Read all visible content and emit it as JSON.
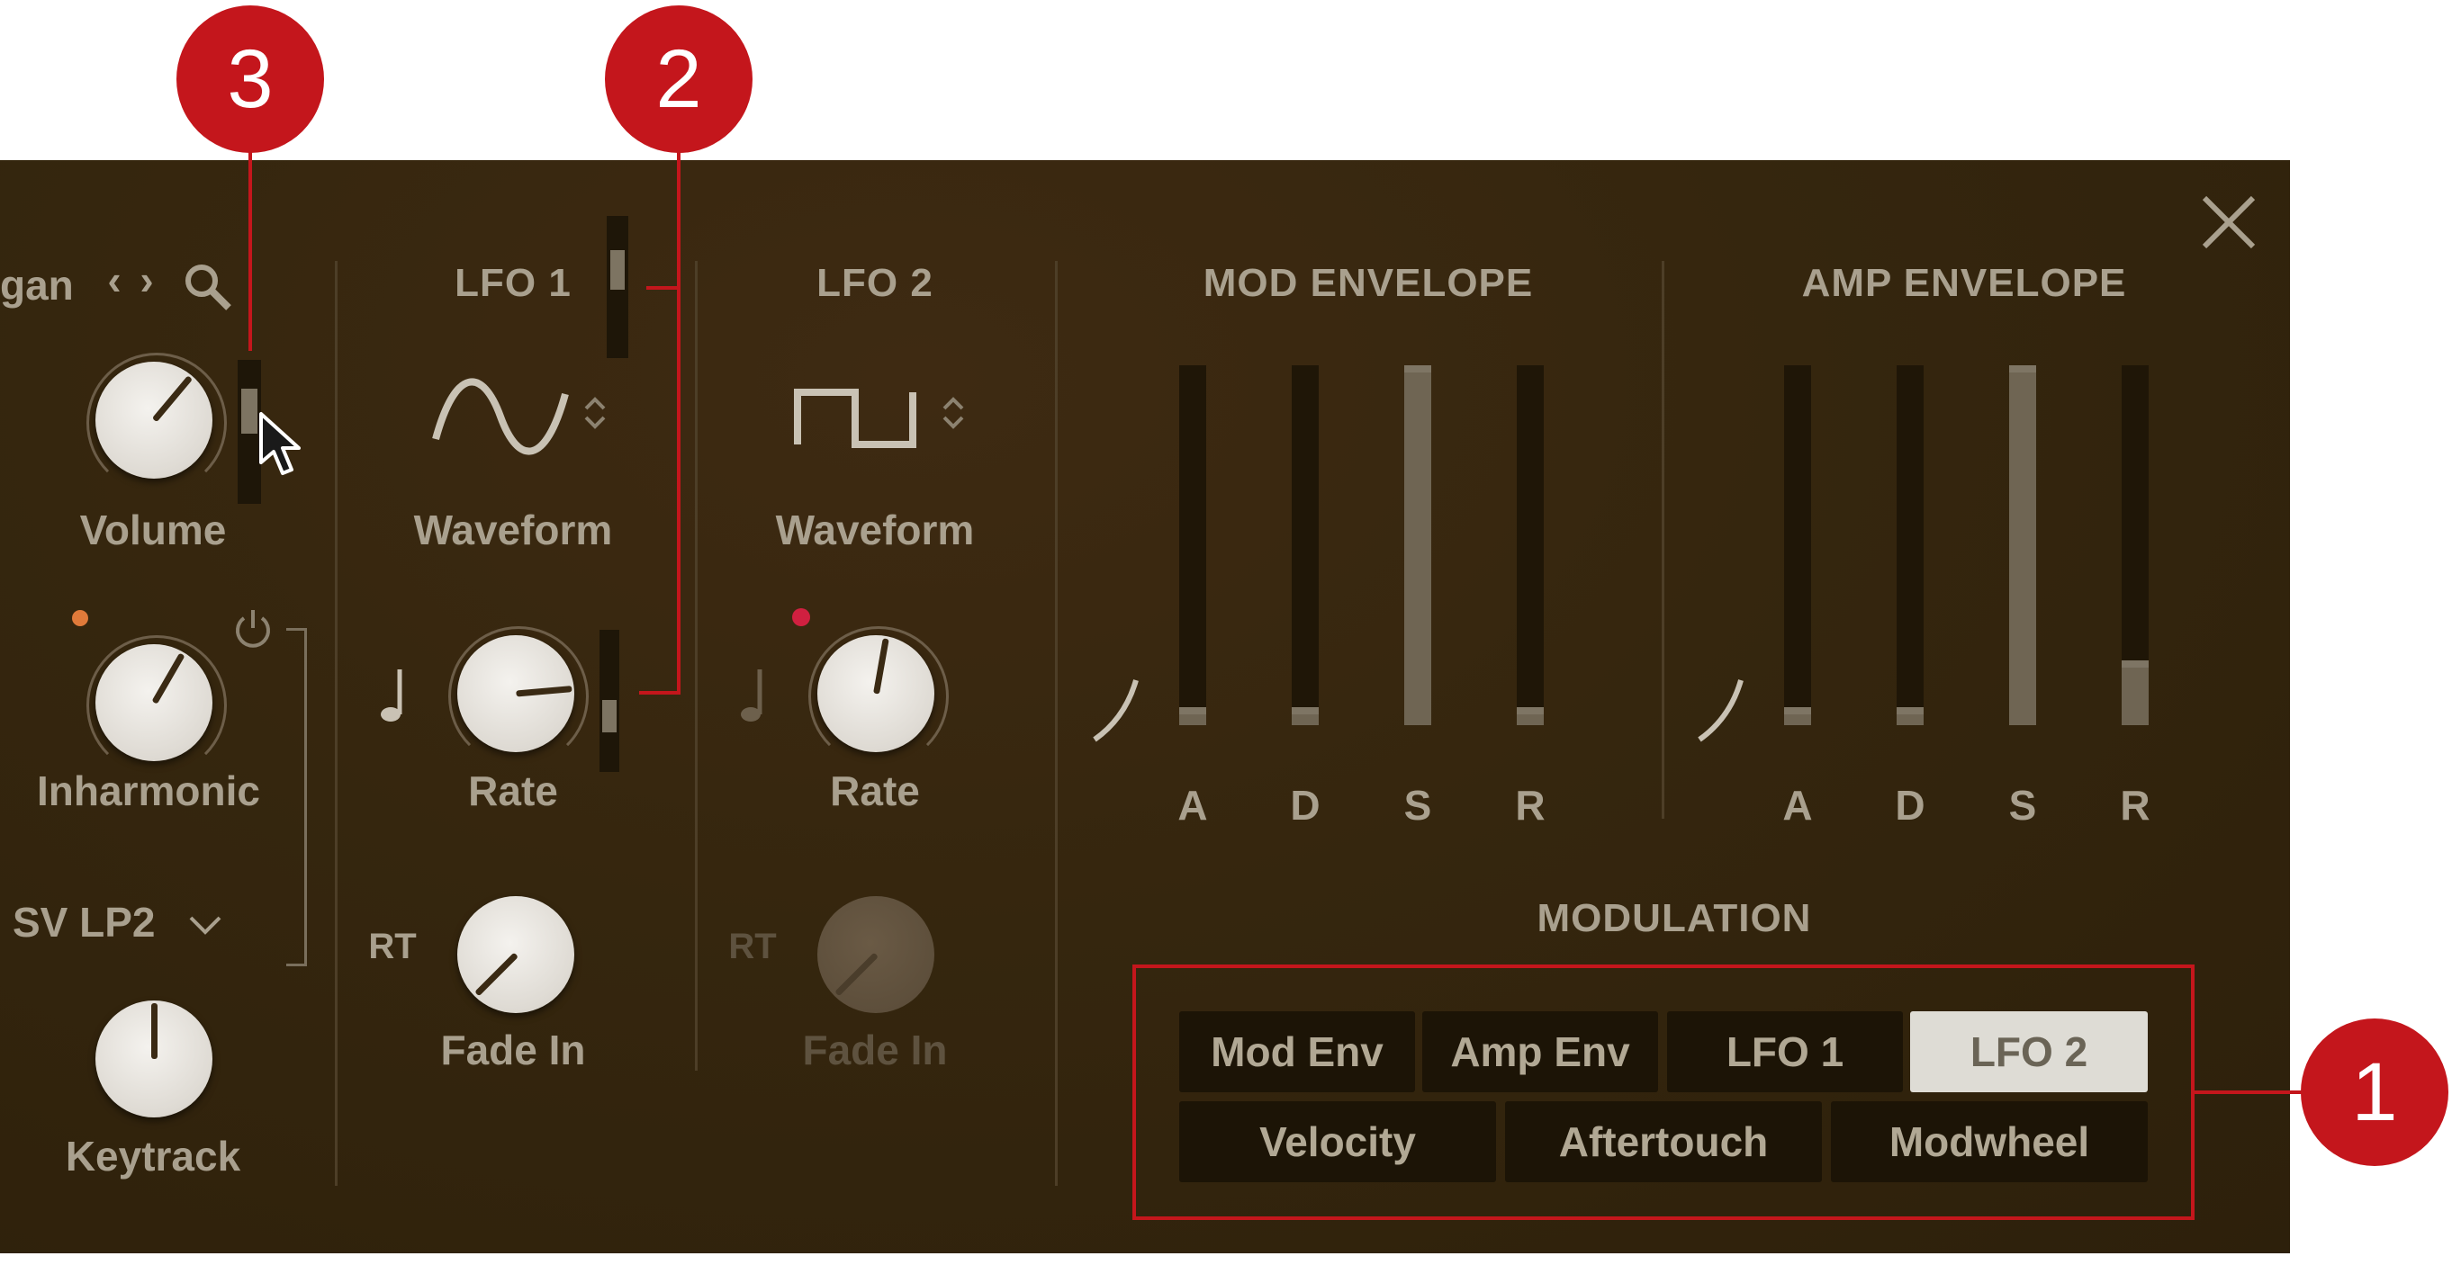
{
  "callouts": {
    "c1": "1",
    "c2": "2",
    "c3": "3"
  },
  "preset": {
    "name_fragment": "gan",
    "prev_icon": "‹",
    "next_icon": "›"
  },
  "osc": {
    "volume_label": "Volume",
    "inharmonic_label": "Inharmonic",
    "filter_type": "SV LP2",
    "keytrack_label": "Keytrack"
  },
  "lfo1": {
    "title": "LFO 1",
    "waveform_label": "Waveform",
    "rate_label": "Rate",
    "rt_label": "RT",
    "fade_label": "Fade In"
  },
  "lfo2": {
    "title": "LFO 2",
    "waveform_label": "Waveform",
    "rate_label": "Rate",
    "rt_label": "RT",
    "fade_label": "Fade In"
  },
  "mod_envelope": {
    "title": "MOD ENVELOPE",
    "stages": [
      "A",
      "D",
      "S",
      "R"
    ],
    "levels": [
      0.05,
      0.05,
      1.0,
      0.05
    ]
  },
  "amp_envelope": {
    "title": "AMP ENVELOPE",
    "stages": [
      "A",
      "D",
      "S",
      "R"
    ],
    "levels": [
      0.05,
      0.05,
      1.0,
      0.18
    ]
  },
  "modulation": {
    "title": "MODULATION",
    "row1": [
      "Mod Env",
      "Amp Env",
      "LFO 1",
      "LFO 2"
    ],
    "row2": [
      "Velocity",
      "Aftertouch",
      "Modwheel"
    ],
    "active": "LFO 2"
  },
  "colors": {
    "panel": "#35260e",
    "accent_red": "#c4161c",
    "active_button": "#dedcd5"
  }
}
